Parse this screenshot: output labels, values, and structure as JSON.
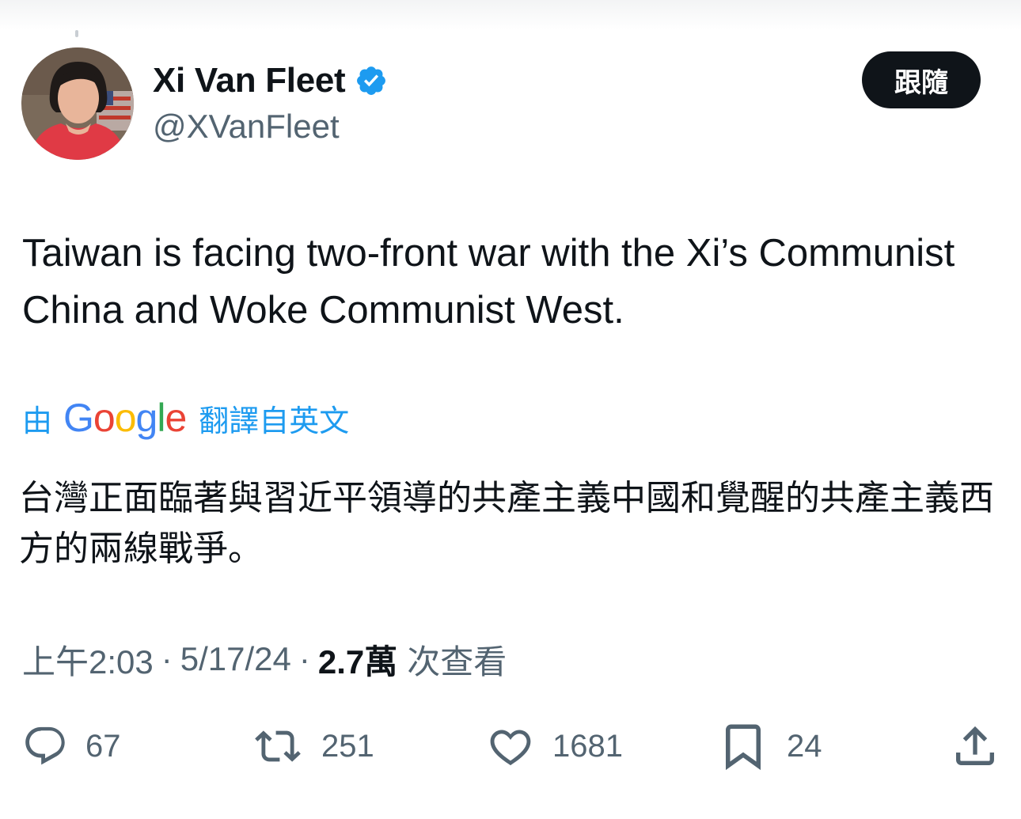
{
  "author": {
    "name": "Xi Van Fleet",
    "handle": "@XVanFleet",
    "verified": true
  },
  "follow_button": {
    "label": "跟隨"
  },
  "tweet": {
    "text": "Taiwan is facing two-front war with the Xi’s Communist China and Woke Communist West."
  },
  "translation": {
    "prefix": "由",
    "provider": [
      "G",
      "o",
      "o",
      "g",
      "l",
      "e"
    ],
    "suffix": "翻譯自英文",
    "text": "台灣正面臨著與習近平領導的共產主義中國和覺醒的共產主義西方的兩線戰爭。"
  },
  "meta": {
    "time": "上午2:03",
    "date": "5/17/24",
    "views": "2.7萬",
    "views_label": "次查看",
    "separator": "·"
  },
  "actions": {
    "replies": "67",
    "reposts": "251",
    "likes": "1681",
    "bookmarks": "24"
  },
  "colors": {
    "accent": "#1d9bf0",
    "text": "#0f1419",
    "secondary": "#536471"
  },
  "icons": [
    "verified-badge-icon",
    "reply-icon",
    "repost-icon",
    "like-icon",
    "bookmark-icon",
    "share-icon"
  ]
}
